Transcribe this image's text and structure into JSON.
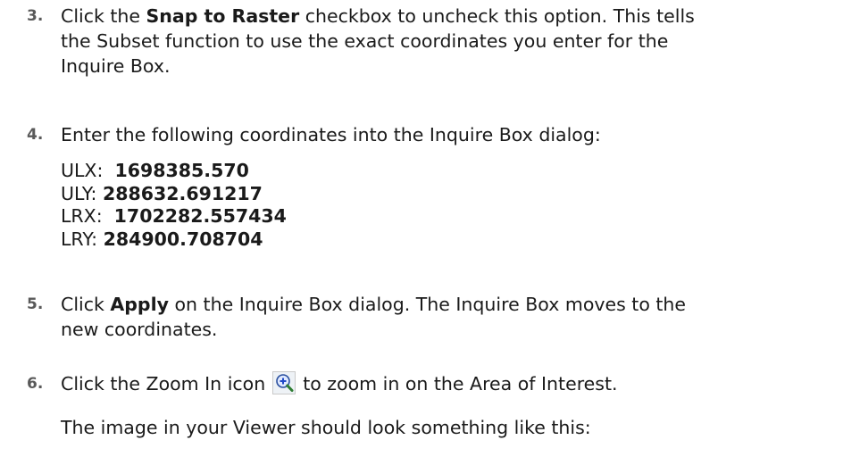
{
  "steps": [
    {
      "num": "3.",
      "pre": "Click the ",
      "bold": "Snap to Raster",
      "line1_rest": " checkbox to uncheck this option. This tells",
      "line2": "the Subset function to use the exact coordinates you enter for the",
      "line3": "Inquire Box."
    },
    {
      "num": "4.",
      "text": "Enter the following coordinates into the Inquire Box dialog:",
      "coords": [
        {
          "label": "ULX:",
          "value": "1698385.570"
        },
        {
          "label": "ULY:",
          "value": "288632.691217"
        },
        {
          "label": "LRX:",
          "value": "1702282.557434"
        },
        {
          "label": "LRY:",
          "value": "284900.708704"
        }
      ]
    },
    {
      "num": "5.",
      "pre": "Click ",
      "bold": "Apply",
      "line1_rest": " on the Inquire Box dialog. The Inquire Box moves to the",
      "line2": "new coordinates."
    },
    {
      "num": "6.",
      "pre": "Click the Zoom In icon",
      "icon": "zoom-in-icon",
      "post": "to zoom in on the Area of Interest."
    }
  ],
  "note": "The image in your Viewer should look something like this:"
}
